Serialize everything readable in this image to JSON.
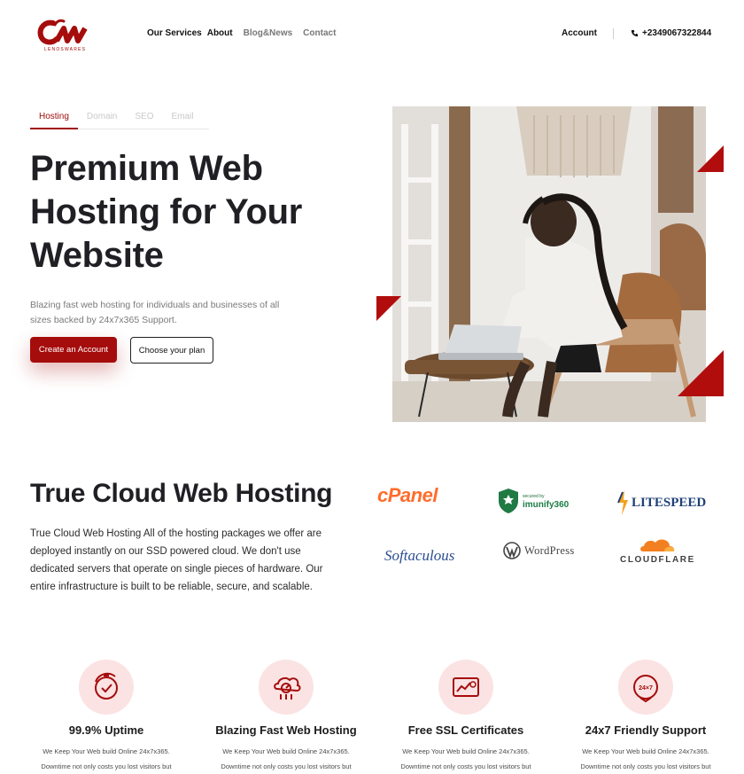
{
  "brand": {
    "logo_text": "LENOSWARES",
    "accent": "#a50c0c",
    "soft_accent": "#fbe3e3"
  },
  "nav": {
    "services": "Our Services",
    "about": "About",
    "blog": "Blog&News",
    "contact": "Contact",
    "account": "Account",
    "phone": "+2349067322844"
  },
  "hero": {
    "tabs": [
      "Hosting",
      "Domain",
      "SEO",
      "Email"
    ],
    "active_tab": "Hosting",
    "title": "Premium Web Hosting for Your Website",
    "subtitle": "Blazing fast web hosting for individuals and businesses of all sizes backed by 24x7x365 Support.",
    "primary_button": "Create an Account",
    "secondary_button": "Choose your plan"
  },
  "cloud": {
    "title": "True Cloud Web Hosting",
    "body": "True Cloud Web Hosting All of the hosting packages we offer are deployed instantly on our SSD powered cloud. We don't use dedicated servers that operate on single pieces of hardware. Our entire infrastructure is built to be reliable, secure, and scalable.",
    "partners": {
      "cpanel": "cPanel",
      "imunify_small": "secured by",
      "imunify": "imunify360",
      "litespeed": "LITESPEED",
      "softaculous": "Softaculous",
      "wordpress": "WordPress",
      "cloudflare": "CLOUDFLARE"
    }
  },
  "features": [
    {
      "title": "99.9% Uptime",
      "icon": "uptime-icon",
      "desc1": "We Keep Your Web build Online 24x7x365.",
      "desc2": "Downtime not only costs you lost visitors but"
    },
    {
      "title": "Blazing Fast Web Hosting",
      "icon": "speed-cloud-icon",
      "desc1": "We Keep Your Web build Online 24x7x365.",
      "desc2": "Downtime not only costs you lost visitors but"
    },
    {
      "title": "Free SSL Certificates",
      "icon": "ssl-icon",
      "desc1": "We Keep Your Web build Online 24x7x365.",
      "desc2": "Downtime not only costs you lost visitors but"
    },
    {
      "title": "24x7 Friendly Support",
      "icon": "support-24x7-icon",
      "icon_text": "24×7",
      "desc1": "We Keep Your Web build Online 24x7x365.",
      "desc2": "Downtime not only costs you lost visitors but"
    }
  ]
}
